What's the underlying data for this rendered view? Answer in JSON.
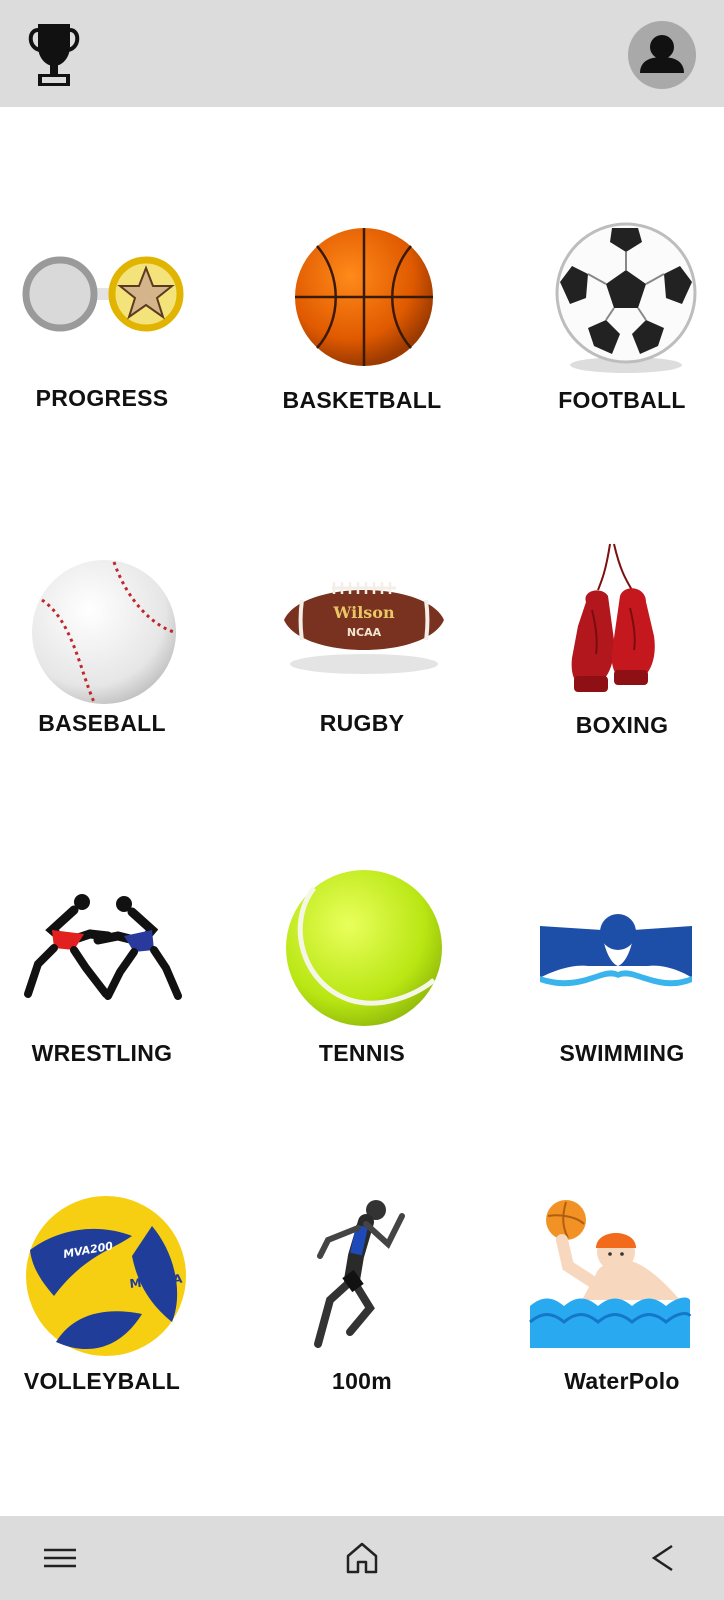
{
  "header": {
    "trophy_icon": "trophy-icon",
    "profile_icon": "profile-avatar-icon"
  },
  "sports": [
    {
      "label": "PROGRESS",
      "icon": "progress-medals-icon"
    },
    {
      "label": "BASKETBALL",
      "icon": "basketball-icon"
    },
    {
      "label": "FOOTBALL",
      "icon": "soccer-ball-icon"
    },
    {
      "label": "BASEBALL",
      "icon": "baseball-icon"
    },
    {
      "label": "RUGBY",
      "icon": "american-football-icon"
    },
    {
      "label": "BOXING",
      "icon": "boxing-gloves-icon"
    },
    {
      "label": "WRESTLING",
      "icon": "wrestlers-icon"
    },
    {
      "label": "TENNIS",
      "icon": "tennis-ball-icon"
    },
    {
      "label": "SWIMMING",
      "icon": "swimmer-icon"
    },
    {
      "label": "VOLLEYBALL",
      "icon": "volleyball-icon"
    },
    {
      "label": "100m",
      "icon": "sprinter-icon"
    },
    {
      "label": "WaterPolo",
      "icon": "water-polo-icon"
    }
  ],
  "artwork_text": {
    "rugby_brand": "Wilson",
    "rugby_league": "NCAA",
    "volleyball_model": "MVA200",
    "volleyball_brand": "MIKASA"
  },
  "navbar": {
    "menu_icon": "menu-icon",
    "home_icon": "home-icon",
    "back_icon": "back-icon"
  },
  "colors": {
    "bar_background": "#dcdcdc",
    "page_background": "#ffffff",
    "label_text": "#111111"
  }
}
